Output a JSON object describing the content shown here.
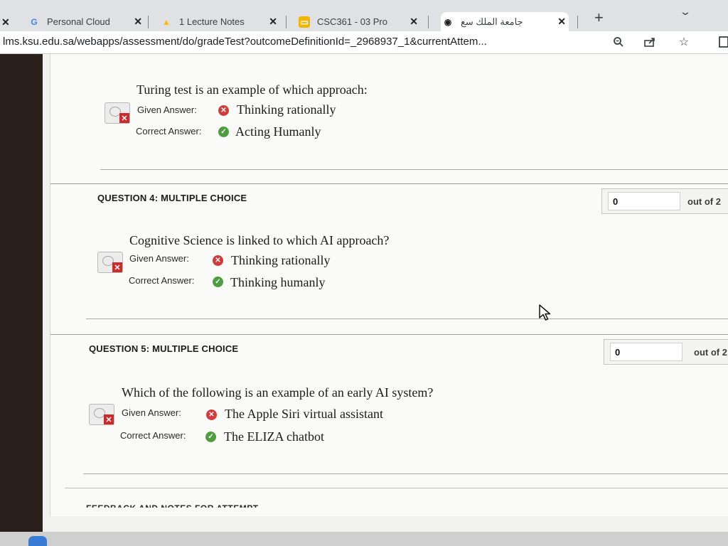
{
  "browser": {
    "tabs": [
      {
        "title": "Personal Cloud",
        "favicon": "google-icon",
        "favicon_char": "G",
        "color": "#4285f4"
      },
      {
        "title": "1 Lecture Notes",
        "favicon": "drive-icon",
        "favicon_char": "▲",
        "color": "#fbbc04"
      },
      {
        "title": "CSC361 - 03 Pro",
        "favicon": "slides-icon",
        "favicon_char": "▭",
        "color": "#f4b400"
      },
      {
        "title": "جامعة الملك سع",
        "favicon": "globe-icon",
        "favicon_char": "◉",
        "color": "#202124"
      }
    ],
    "url_host": "lms.ksu.edu.sa",
    "url_path": "/webapps/assessment/do/gradeTest?outcomeDefinitionId=_2968937_1&currentAttem..."
  },
  "labels": {
    "given": "Given Answer:",
    "correct": "Correct Answer:"
  },
  "prev_question": {
    "text": "Turing test is an example of which approach:",
    "given": "Thinking rationally",
    "correct": "Acting Humanly"
  },
  "questions": [
    {
      "label": "QUESTION 4:  MULTIPLE CHOICE",
      "score": "0",
      "out_of": "out of 2",
      "text": "Cognitive Science is linked to which AI approach?",
      "given": "Thinking rationally",
      "correct": "Thinking humanly"
    },
    {
      "label": "QUESTION 5:  MULTIPLE CHOICE",
      "score": "0",
      "out_of": "out of 2",
      "text": "Which of the following is an example of an early AI system?",
      "given": "The Apple Siri virtual assistant",
      "correct": "The ELIZA chatbot"
    }
  ],
  "footer": "FEEDBACK AND NOTES FOR ATTEMPT",
  "colors": {
    "wrong": "#d33b3b",
    "correct": "#4c9e3e"
  }
}
